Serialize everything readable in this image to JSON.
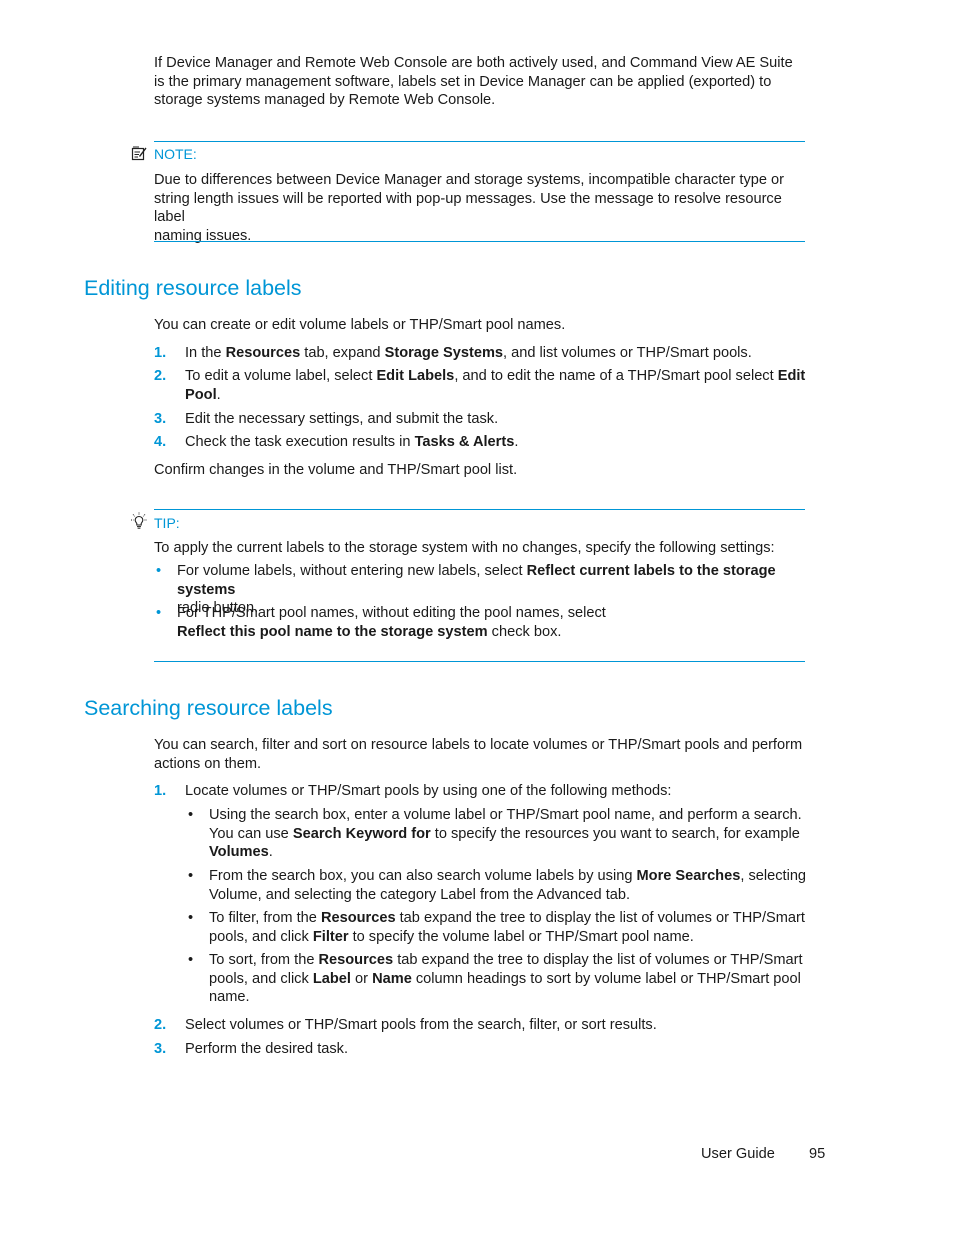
{
  "intro": {
    "lines": [
      "If Device Manager and Remote Web Console are both actively used, and Command View AE Suite",
      "is the primary management software, labels set in Device Manager can be applied (exported) to",
      "storage systems managed by Remote Web Console."
    ]
  },
  "note": {
    "icon": "note-icon",
    "label": "NOTE:",
    "lines": [
      "Due to differences between Device Manager and storage systems, incompatible character type or",
      "string length issues will be reported with pop-up messages. Use the message to resolve resource label",
      "naming issues."
    ]
  },
  "editing": {
    "title": "Editing resource labels",
    "intro": "You can create or edit volume labels or THP/Smart pool names.",
    "steps": [
      {
        "num": "1.",
        "parts": [
          "In the ",
          "Resources",
          " tab, expand ",
          "Storage Systems",
          ", and list volumes or THP/Smart pools."
        ]
      },
      {
        "num": "2.",
        "parts": [
          "To edit a volume label, select ",
          "Edit Labels",
          ", and to edit the name of a THP/Smart pool select ",
          "Edit",
          "Pool",
          "."
        ]
      },
      {
        "num": "3.",
        "text": "Edit the necessary settings, and submit the task."
      },
      {
        "num": "4.",
        "parts": [
          "Check the task execution results in ",
          "Tasks & Alerts",
          "."
        ]
      }
    ],
    "confirm": "Confirm changes in the volume and THP/Smart pool list."
  },
  "tip": {
    "icon": "lightbulb-icon",
    "label": "TIP:",
    "intro": "To apply the current labels to the storage system with no changes, specify the following settings:",
    "bullets": [
      {
        "pre": "For volume labels, without entering new labels, select ",
        "bold": "Reflect current labels to the storage systems",
        "post": "radio button."
      },
      {
        "pre": "For THP/Smart pool names, without editing the pool names, select",
        "bold": "Reflect this pool name to the storage system",
        "post": " check box."
      }
    ]
  },
  "searching": {
    "title": "Searching resource labels",
    "intro_lines": [
      "You can search, filter and sort on resource labels to locate volumes or THP/Smart pools and perform",
      "actions on them."
    ],
    "step1": {
      "num": "1.",
      "text": "Locate volumes or THP/Smart pools by using one of the following methods:",
      "sub": [
        {
          "l1": "Using the search box, enter a volume label or THP/Smart pool name, and perform a search.",
          "l2a": "You can use ",
          "l2b": "Search Keyword for",
          "l2c": " to specify the resources you want to search, for example",
          "l3b": "Volumes",
          "l3c": "."
        },
        {
          "l1a": "From the search box, you can also search volume labels by using ",
          "l1b": "More Searches",
          "l1c": ", selecting",
          "l2": "Volume, and selecting the category Label from the Advanced tab."
        },
        {
          "l1a": "To filter, from the ",
          "l1b": "Resources",
          "l1c": " tab expand the tree to display the list of volumes or THP/Smart",
          "l2a": "pools, and click ",
          "l2b": "Filter",
          "l2c": " to specify the volume label or THP/Smart pool name."
        },
        {
          "l1a": "To sort, from the ",
          "l1b": "Resources",
          "l1c": " tab expand the tree to display the list of volumes or THP/Smart",
          "l2a": "pools, and click ",
          "l2b": "Label",
          "l2c": " or ",
          "l2d": "Name",
          "l2e": " column headings to sort by volume label or THP/Smart pool",
          "l3": "name."
        }
      ]
    },
    "step2": {
      "num": "2.",
      "text": "Select volumes or THP/Smart pools from the search, filter, or sort results."
    },
    "step3": {
      "num": "3.",
      "text": "Perform the desired task."
    }
  },
  "footer": {
    "guide": "User Guide",
    "page": "95"
  }
}
